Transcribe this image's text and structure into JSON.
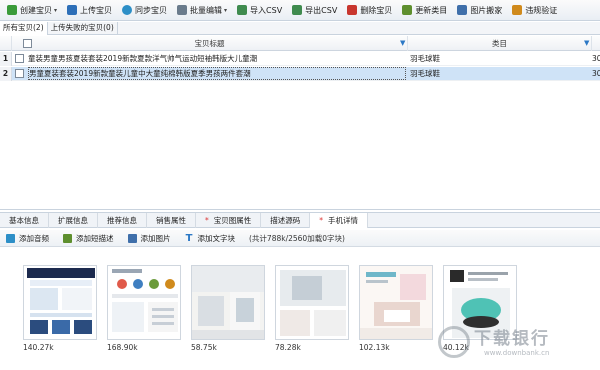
{
  "toolbar": {
    "items": [
      {
        "label": "创建宝贝",
        "icon": "create-item-icon",
        "color": "#3a9b3a",
        "caret": true
      },
      {
        "label": "上传宝贝",
        "icon": "upload-icon",
        "color": "#2d6fb8",
        "caret": false
      },
      {
        "label": "同步宝贝",
        "icon": "sync-icon",
        "color": "#2d8fc7",
        "caret": false
      },
      {
        "label": "批量编辑",
        "icon": "batch-edit-icon",
        "color": "#6a7b8c",
        "caret": true
      },
      {
        "label": "导入CSV",
        "icon": "import-csv-icon",
        "color": "#3f8b4e",
        "caret": false
      },
      {
        "label": "导出CSV",
        "icon": "export-csv-icon",
        "color": "#3f8b4e",
        "caret": false
      },
      {
        "label": "删除宝贝",
        "icon": "delete-icon",
        "color": "#c8362e",
        "caret": false
      },
      {
        "label": "更新类目",
        "icon": "update-category-icon",
        "color": "#5e8f2e",
        "caret": false
      },
      {
        "label": "图片搬家",
        "icon": "image-move-icon",
        "color": "#3f6faa",
        "caret": false
      },
      {
        "label": "违规验证",
        "icon": "violation-check-icon",
        "color": "#d08a1c",
        "caret": false
      }
    ]
  },
  "subtabs": [
    {
      "label": "所有宝贝(2)",
      "active": true
    },
    {
      "label": "上传失败的宝贝(0)",
      "active": false
    }
  ],
  "grid": {
    "columns": {
      "title": "宝贝标题",
      "category": "类目"
    },
    "rows": [
      {
        "num": "1",
        "title": "童装男童男孩夏装套装2019新款夏款洋气帅气运动短袖韩版大儿童潮",
        "category": "羽毛球鞋",
        "extra": "30",
        "selected": false
      },
      {
        "num": "2",
        "title": "男童夏装套装2019新款童装儿童中大童纯棉韩版夏季男孩两件套潮",
        "category": "羽毛球鞋",
        "extra": "30",
        "selected": true
      }
    ]
  },
  "detail_tabs": [
    {
      "label": "基本信息",
      "star": false,
      "active": false
    },
    {
      "label": "扩展信息",
      "star": false,
      "active": false
    },
    {
      "label": "推荐信息",
      "star": false,
      "active": false
    },
    {
      "label": "销售属性",
      "star": false,
      "active": false
    },
    {
      "label": "宝贝图属性",
      "star": true,
      "active": false
    },
    {
      "label": "描述源码",
      "star": false,
      "active": false
    },
    {
      "label": "手机详情",
      "star": true,
      "active": true
    }
  ],
  "detail_tools": {
    "add_audio": "添加音频",
    "add_summary": "添加短描述",
    "add_image": "添加图片",
    "add_text": "添加文字块",
    "note": "(共计788k/2560加载0字块)"
  },
  "images": [
    {
      "size": "140.27k",
      "icon": "product-image-1"
    },
    {
      "size": "168.90k",
      "icon": "product-image-2"
    },
    {
      "size": "58.75k",
      "icon": "product-image-3"
    },
    {
      "size": "78.28k",
      "icon": "product-image-4"
    },
    {
      "size": "102.13k",
      "icon": "product-image-5"
    },
    {
      "size": "40.12k",
      "icon": "product-image-6"
    }
  ],
  "watermark": {
    "text": "下载银行",
    "url": "www.downbank.cn"
  },
  "colors": {
    "selection": "#cfe3f7",
    "accent": "#2b78c5",
    "star": "#dd3333"
  }
}
